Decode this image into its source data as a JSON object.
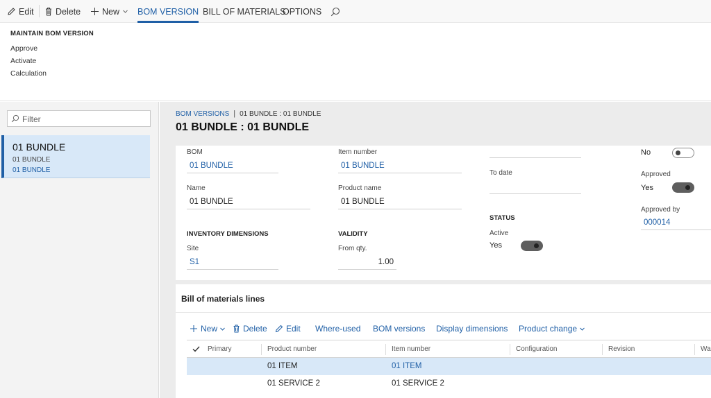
{
  "toolbar": {
    "edit": "Edit",
    "delete": "Delete",
    "new": "New",
    "tabs": [
      "BOM VERSION",
      "BILL OF MATERIALS",
      "OPTIONS"
    ]
  },
  "action_pane": {
    "group_title": "MAINTAIN BOM VERSION",
    "items": [
      "Approve",
      "Activate",
      "Calculation"
    ]
  },
  "left_pane": {
    "filter_placeholder": "Filter",
    "selected_item": {
      "title": "01 BUNDLE",
      "line1": "01 BUNDLE",
      "line2": "01 BUNDLE"
    }
  },
  "header": {
    "breadcrumb_link": "BOM VERSIONS",
    "breadcrumb_current": "01 BUNDLE : 01 BUNDLE",
    "title": "01 BUNDLE : 01 BUNDLE"
  },
  "form": {
    "bom_label": "BOM",
    "bom_value": "01 BUNDLE",
    "item_number_label": "Item number",
    "item_number_value": "01 BUNDLE",
    "name_label": "Name",
    "name_value": "01 BUNDLE",
    "product_name_label": "Product name",
    "product_name_value": "01 BUNDLE",
    "to_date_label": "To date",
    "inventory_dimensions_heading": "INVENTORY DIMENSIONS",
    "site_label": "Site",
    "site_value": "S1",
    "validity_heading": "VALIDITY",
    "from_qty_label": "From qty.",
    "from_qty_value": "1.00",
    "status_heading": "STATUS",
    "active_label": "Active",
    "active_value": "Yes",
    "no_toggle_value": "No",
    "approved_label": "Approved",
    "approved_value": "Yes",
    "approved_by_label": "Approved by",
    "approved_by_value": "000014"
  },
  "lines": {
    "title": "Bill of materials lines",
    "toolbar": {
      "new": "New",
      "delete": "Delete",
      "edit": "Edit",
      "where_used": "Where-used",
      "bom_versions": "BOM versions",
      "display_dimensions": "Display dimensions",
      "product_change": "Product change"
    },
    "columns": [
      "Primary",
      "Product number",
      "Item number",
      "Configuration",
      "Revision",
      "Wa"
    ],
    "rows": [
      {
        "product_number": "01 ITEM",
        "item_number": "01 ITEM"
      },
      {
        "product_number": "01 SERVICE 2",
        "item_number": "01 SERVICE 2"
      }
    ]
  },
  "colors": {
    "accent": "#1f5fa6",
    "selected_bg": "#d8e8f8"
  }
}
